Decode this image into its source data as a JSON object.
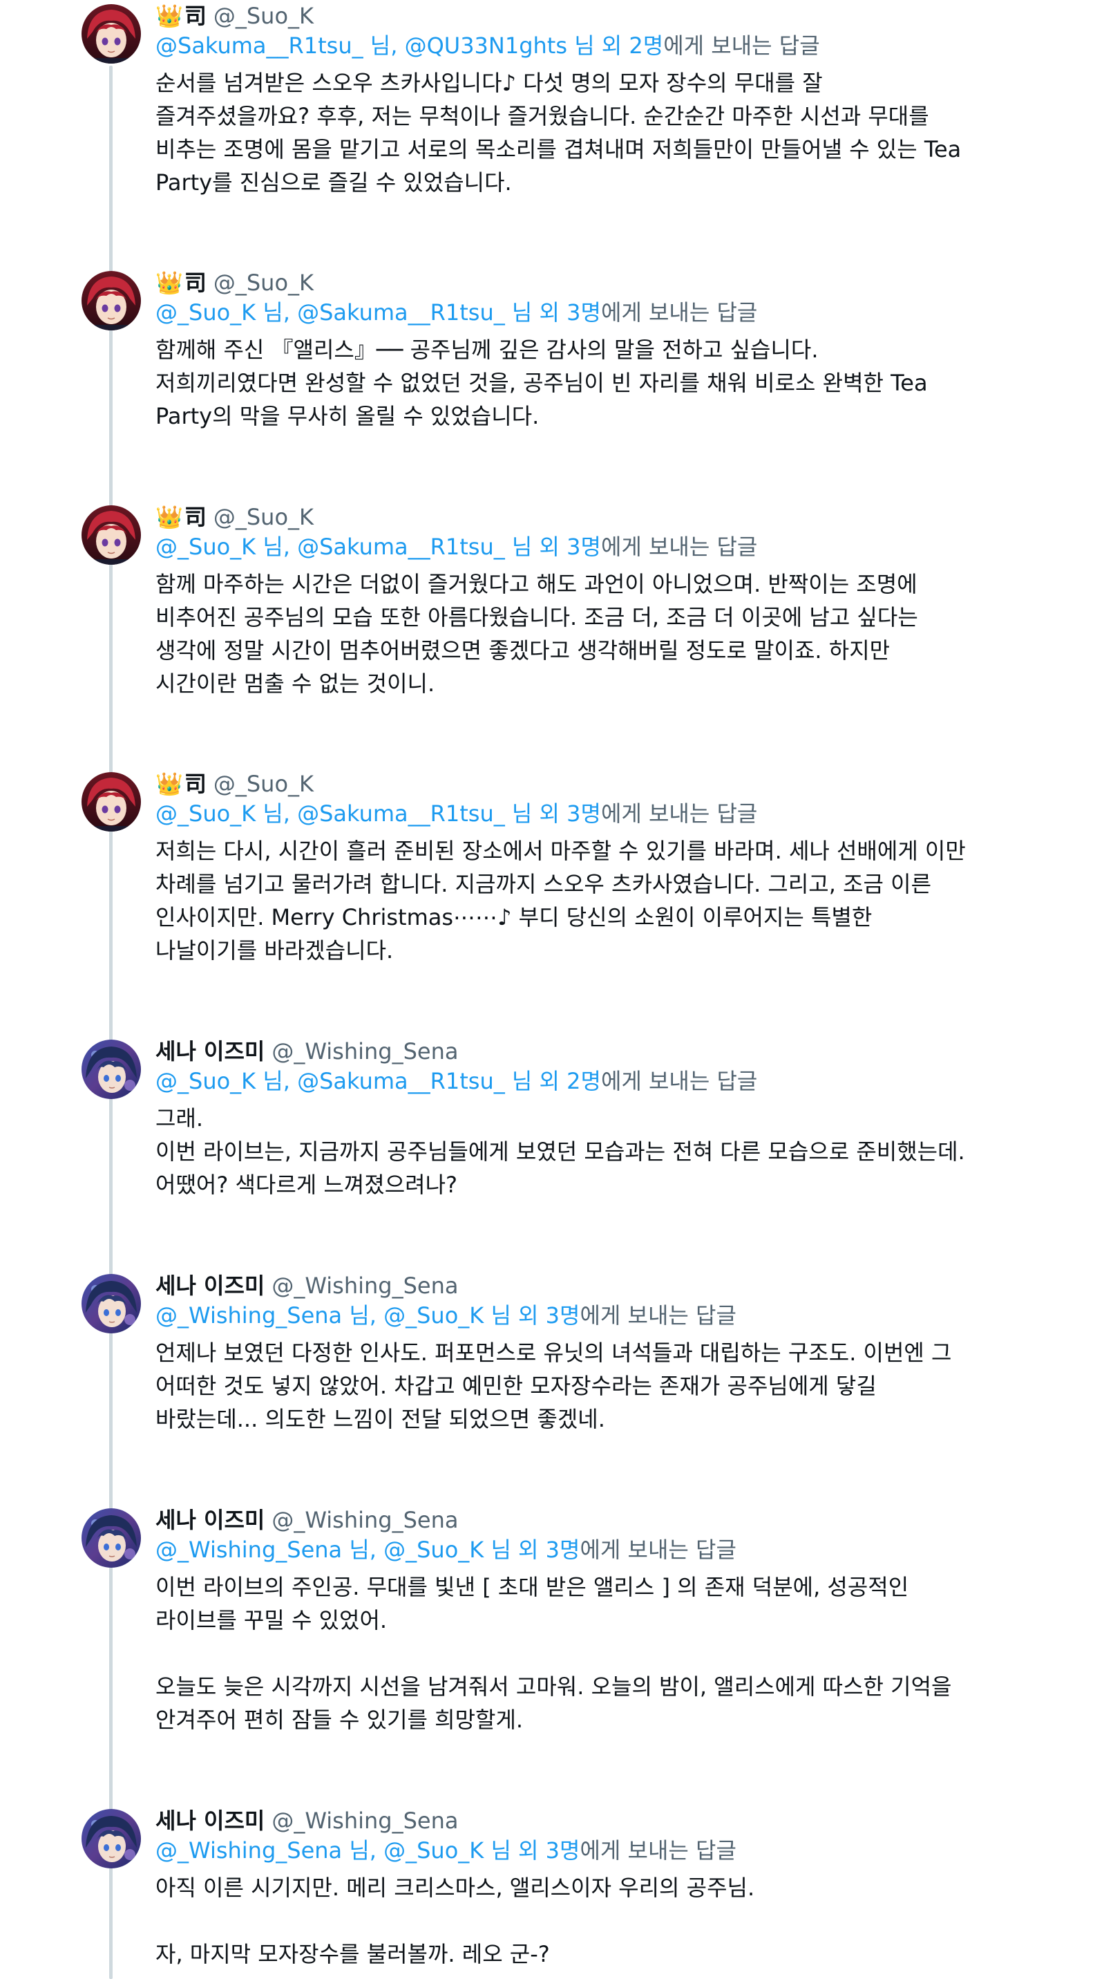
{
  "colors": {
    "link": "#1d9bf0",
    "secondary_text": "#536471",
    "primary_text": "#0f1419",
    "thread_line": "#cfd9de"
  },
  "tweets": [
    {
      "crown": "👑",
      "name": "司",
      "handle": "@_Suo_K",
      "reply_mentions": "@Sakuma__R1tsu_ 님, @QU33N1ghts 님 외 2명",
      "reply_suffix": "에게 보내는 답글",
      "text": "순서를 넘겨받은 스오우 츠카사입니다♪ 다섯 명의 모자 장수의 무대를 잘\n즐겨주셨을까요? 후후, 저는 무척이나 즐거웠습니다. 순간순간 마주한 시선과 무대를\n비추는 조명에 몸을 맡기고 서로의 목소리를 겹쳐내며 저희들만이 만들어낼 수 있는 Tea\nParty를 진심으로 즐길 수 있었습니다.",
      "avatar": "crimson-hair-avatar"
    },
    {
      "crown": "👑",
      "name": "司",
      "handle": "@_Suo_K",
      "reply_mentions": "@_Suo_K 님, @Sakuma__R1tsu_ 님 외 3명",
      "reply_suffix": "에게 보내는 답글",
      "text": "함께해 주신 『앨리스』── 공주님께 깊은 감사의 말을 전하고 싶습니다.\n저희끼리였다면 완성할 수 없었던 것을, 공주님이 빈 자리를 채워 비로소 완벽한 Tea\nParty의 막을 무사히 올릴 수 있었습니다.",
      "avatar": "crimson-hair-avatar"
    },
    {
      "crown": "👑",
      "name": "司",
      "handle": "@_Suo_K",
      "reply_mentions": "@_Suo_K 님, @Sakuma__R1tsu_ 님 외 3명",
      "reply_suffix": "에게 보내는 답글",
      "text": "함께 마주하는 시간은 더없이 즐거웠다고 해도 과언이 아니었으며. 반짝이는 조명에\n비추어진 공주님의 모습 또한 아름다웠습니다. 조금 더, 조금 더 이곳에 남고 싶다는\n생각에 정말 시간이 멈추어버렸으면 좋겠다고 생각해버릴 정도로 말이죠. 하지만\n시간이란 멈출 수 없는 것이니.",
      "avatar": "crimson-hair-avatar"
    },
    {
      "crown": "👑",
      "name": "司",
      "handle": "@_Suo_K",
      "reply_mentions": "@_Suo_K 님, @Sakuma__R1tsu_ 님 외 3명",
      "reply_suffix": "에게 보내는 답글",
      "text": "저희는 다시, 시간이 흘러 준비된 장소에서 마주할 수 있기를 바라며. 세나 선배에게 이만\n차례를 넘기고 물러가려 합니다. 지금까지 스오우 츠카사였습니다. 그리고, 조금 이른\n인사이지만. Merry Christmas⋯⋯♪ 부디 당신의 소원이 이루어지는 특별한\n나날이기를 바라겠습니다.",
      "avatar": "crimson-hair-avatar"
    },
    {
      "crown": "",
      "name": "세나 이즈미",
      "handle": "@_Wishing_Sena",
      "reply_mentions": "@_Suo_K 님, @Sakuma__R1tsu_ 님 외 2명",
      "reply_suffix": "에게 보내는 답글",
      "text": "그래.\n 이번 라이브는, 지금까지 공주님들에게 보였던 모습과는 전혀 다른 모습으로 준비했는데.\n어땠어? 색다르게 느껴졌으려나?",
      "avatar": "navy-hair-avatar"
    },
    {
      "crown": "",
      "name": "세나 이즈미",
      "handle": "@_Wishing_Sena",
      "reply_mentions": "@_Wishing_Sena 님, @_Suo_K 님 외 3명",
      "reply_suffix": "에게 보내는 답글",
      "text": "언제나 보였던 다정한 인사도. 퍼포먼스로 유닛의 녀석들과 대립하는 구조도. 이번엔 그\n어떠한 것도 넣지 않았어. 차갑고 예민한 모자장수라는 존재가 공주님에게 닿길\n바랐는데... 의도한 느낌이 전달 되었으면 좋겠네.",
      "avatar": "navy-hair-avatar"
    },
    {
      "crown": "",
      "name": "세나 이즈미",
      "handle": "@_Wishing_Sena",
      "reply_mentions": "@_Wishing_Sena 님, @_Suo_K 님 외 3명",
      "reply_suffix": "에게 보내는 답글",
      "text": "이번 라이브의 주인공. 무대를 빛낸 [ 초대 받은 앨리스 ] 의 존재 덕분에, 성공적인\n라이브를 꾸밀 수 있었어.\n\n오늘도 늦은 시각까지 시선을 남겨줘서 고마워. 오늘의 밤이, 앨리스에게 따스한 기억을\n안겨주어 편히 잠들 수 있기를 희망할게.",
      "avatar": "navy-hair-avatar"
    },
    {
      "crown": "",
      "name": "세나 이즈미",
      "handle": "@_Wishing_Sena",
      "reply_mentions": "@_Wishing_Sena 님, @_Suo_K 님 외 3명",
      "reply_suffix": "에게 보내는 답글",
      "text": "아직 이른 시기지만. 메리 크리스마스, 앨리스이자 우리의 공주님.\n\n자, 마지막 모자장수를 불러볼까. 레오 군-?",
      "avatar": "navy-hair-avatar"
    }
  ]
}
